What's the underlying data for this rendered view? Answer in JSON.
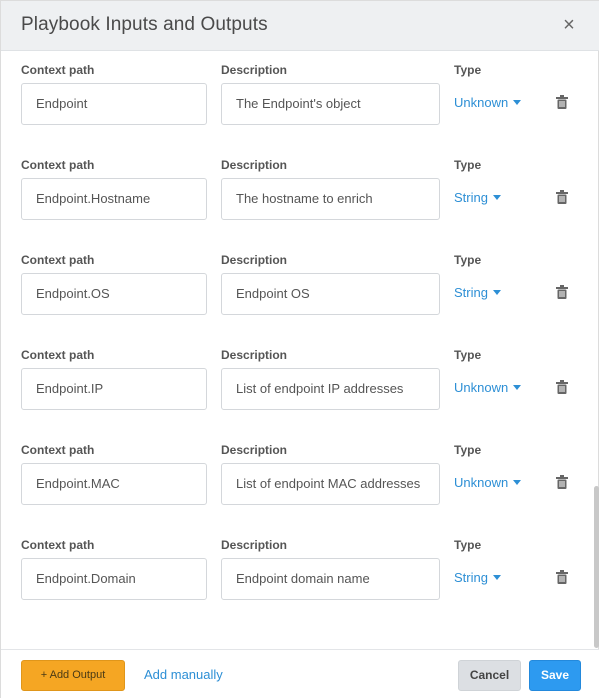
{
  "header": {
    "title": "Playbook Inputs and Outputs",
    "close_glyph": "×"
  },
  "labels": {
    "context_path": "Context path",
    "description": "Description",
    "type": "Type"
  },
  "outputs": [
    {
      "context_path": "Endpoint",
      "description": "The Endpoint's object",
      "type": "Unknown"
    },
    {
      "context_path": "Endpoint.Hostname",
      "description": "The hostname to enrich",
      "type": "String"
    },
    {
      "context_path": "Endpoint.OS",
      "description": "Endpoint OS",
      "type": "String"
    },
    {
      "context_path": "Endpoint.IP",
      "description": "List of endpoint IP addresses",
      "type": "Unknown"
    },
    {
      "context_path": "Endpoint.MAC",
      "description": "List of endpoint MAC addresses",
      "type": "Unknown"
    },
    {
      "context_path": "Endpoint.Domain",
      "description": "Endpoint domain name",
      "type": "String"
    }
  ],
  "footer": {
    "add_output_label": "+ Add Output",
    "add_manually_label": "Add manually",
    "cancel_label": "Cancel",
    "save_label": "Save"
  },
  "icons": {
    "delete": "trash-icon",
    "close": "close-icon",
    "dropdown": "caret-down-icon"
  },
  "colors": {
    "accent": "#2d8fd5",
    "add_button": "#f5a623",
    "save_button": "#2d9af0"
  }
}
